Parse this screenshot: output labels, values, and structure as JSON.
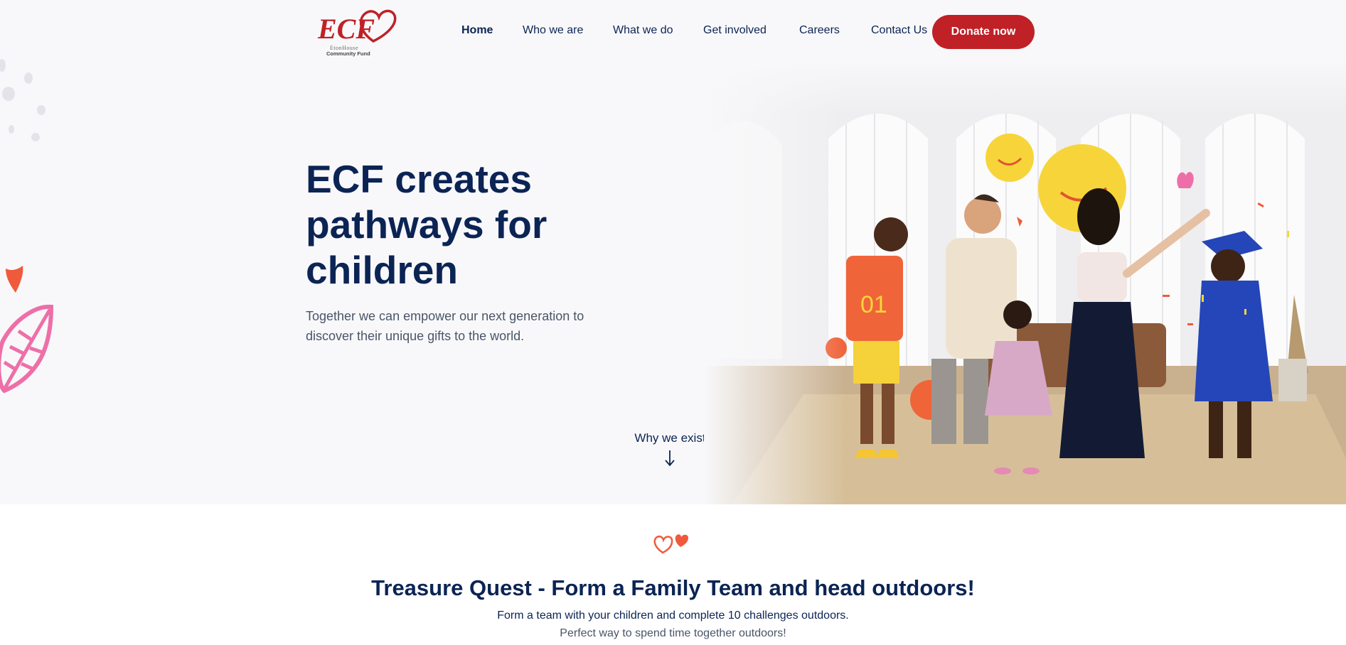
{
  "brand": {
    "logo_text": "ECF",
    "logo_line1": "EtonHouse",
    "logo_line2": "Community Fund"
  },
  "nav": {
    "items": [
      "Home",
      "Who we are",
      "What we do",
      "Get involved",
      "Careers",
      "Contact Us"
    ],
    "donate_label": "Donate now"
  },
  "hero": {
    "title": "ECF creates pathways for children",
    "subtitle": "Together we can empower our next generation to discover their unique gifts to the world.",
    "why_label": "Why we exist",
    "why_arrow": "↓"
  },
  "section": {
    "title": "Treasure Quest - Form a Family Team and head outdoors!",
    "line1": "Form a team with your children and complete 10 challenges outdoors.",
    "line2": "Perfect way to spend time together outdoors!"
  },
  "colors": {
    "brand_red": "#bf2126",
    "navy": "#0b2454",
    "hero_bg": "#f8f8fa",
    "heart_orange": "#f05a3c",
    "leaf_pink": "#ee6fa8"
  },
  "icons": {
    "logo": "heart-logo-icon",
    "down_arrow": "down-arrow-icon",
    "hearts": "hearts-icon"
  }
}
